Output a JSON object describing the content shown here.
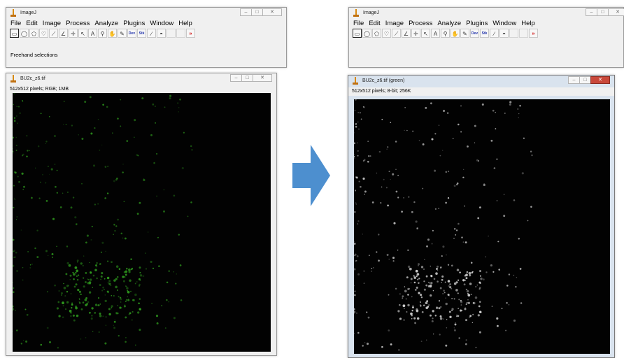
{
  "left": {
    "imagej": {
      "title": "ImageJ",
      "menu": [
        "File",
        "Edit",
        "Image",
        "Process",
        "Analyze",
        "Plugins",
        "Window",
        "Help"
      ],
      "tools": [
        "rectangle-tool",
        "oval-tool",
        "polygon-tool",
        "freehand-tool",
        "line-tool",
        "angle-tool",
        "point-tool",
        "wand-tool",
        "text-tool",
        "magnifier-tool",
        "hand-tool",
        "dropper-tool",
        "dev-tool",
        "stk-tool",
        "brush-tool",
        "flood-fill-tool",
        "blank-tool",
        "blank-tool",
        "more-tools"
      ],
      "status": "Freehand selections"
    },
    "image_window": {
      "title": "BU2c_z6.tif",
      "info": "512x512 pixels; RGB; 1MB",
      "tint": "#2f9a1e"
    }
  },
  "right": {
    "imagej": {
      "title": "ImageJ",
      "menu": [
        "File",
        "Edit",
        "Image",
        "Process",
        "Analyze",
        "Plugins",
        "Window",
        "Help"
      ],
      "tools": [
        "rectangle-tool",
        "oval-tool",
        "polygon-tool",
        "freehand-tool",
        "line-tool",
        "angle-tool",
        "point-tool",
        "wand-tool",
        "text-tool",
        "magnifier-tool",
        "hand-tool",
        "dropper-tool",
        "dev-tool",
        "stk-tool",
        "brush-tool",
        "flood-fill-tool",
        "blank-tool",
        "blank-tool",
        "more-tools"
      ]
    },
    "image_window": {
      "title": "BU2c_z6.tif (green)",
      "info": "512x512 pixels; 8-bit; 256K",
      "tint": "#d8d8d8"
    }
  },
  "tool_glyphs": {
    "rectangle-tool": "▭",
    "oval-tool": "◯",
    "polygon-tool": "⬠",
    "freehand-tool": "♡",
    "line-tool": "⟋",
    "angle-tool": "∠",
    "point-tool": "✛",
    "wand-tool": "↖",
    "text-tool": "A",
    "magnifier-tool": "⚲",
    "hand-tool": "✋",
    "dropper-tool": "✎",
    "dev-tool": "Dev",
    "stk-tool": "Stk",
    "brush-tool": "∕",
    "flood-fill-tool": "◓",
    "blank-tool": "",
    "more-tools": "»"
  },
  "window_controls": [
    "–",
    "□",
    "✕"
  ],
  "arrow_color": "#4d8fcf"
}
